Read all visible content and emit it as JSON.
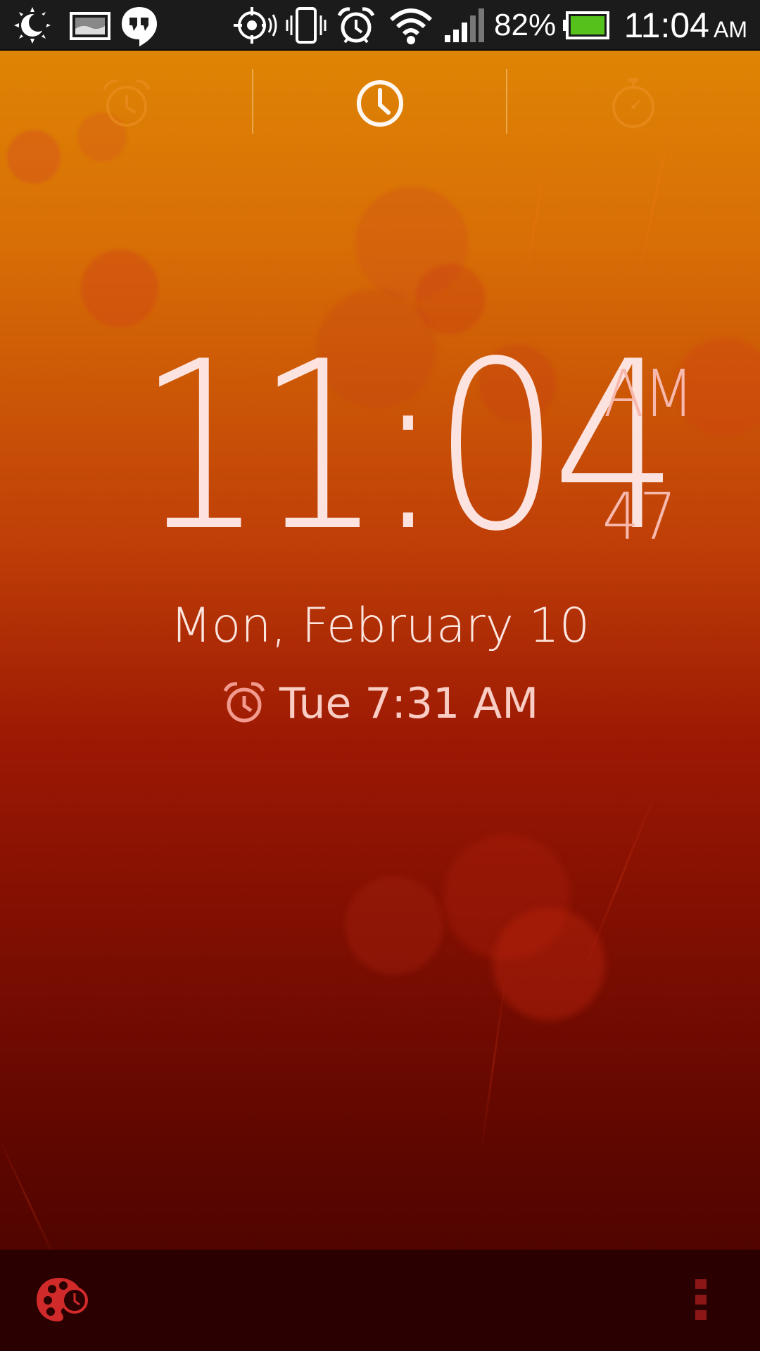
{
  "status_bar": {
    "battery_percent": "82%",
    "time": "11:04",
    "time_suffix": "AM",
    "icons": [
      "weather-icon",
      "gallery-icon",
      "hangouts-icon",
      "location-icon",
      "vibrate-icon",
      "alarm-icon",
      "wifi-icon",
      "signal-icon",
      "battery-icon"
    ],
    "battery_color": "#54c21a"
  },
  "tabs": [
    {
      "name": "alarm",
      "icon": "alarm-clock-icon",
      "active": false
    },
    {
      "name": "clock",
      "icon": "clock-icon",
      "active": true
    },
    {
      "name": "stopwatch",
      "icon": "stopwatch-icon",
      "active": false
    }
  ],
  "clock": {
    "time": "11:04",
    "ampm": "AM",
    "seconds": "47",
    "date": "Mon, February 10",
    "next_alarm": "Tue 7:31 AM"
  },
  "bottom_bar": {
    "theme_icon": "palette-clock-icon",
    "menu_icon": "overflow-menu-icon"
  },
  "colors": {
    "accent": "#d12a2a",
    "text_primary": "#fde3df",
    "text_secondary": "#f7b8ad"
  }
}
